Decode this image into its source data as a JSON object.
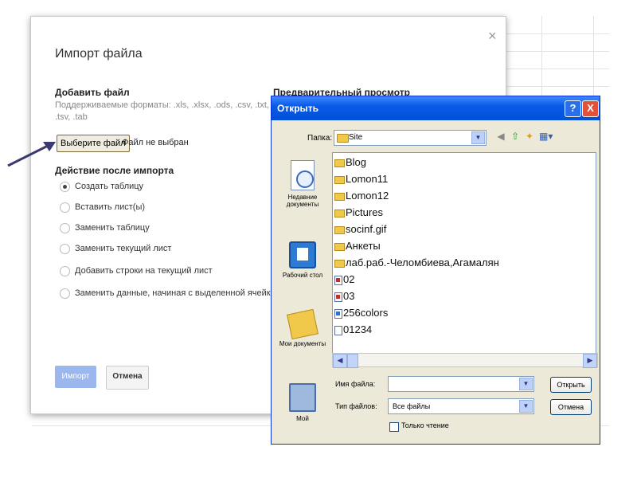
{
  "import_dialog": {
    "title": "Импорт файла",
    "close_glyph": "×",
    "add_file_heading": "Добавить файл",
    "formats_text": "Поддерживаемые форматы: .xls, .xlsx, .ods, .csv, .txt, .tsv, .tab",
    "preview_heading": "Предварительный просмотр",
    "choose_file_button": "Выберите файл",
    "no_file_text": "Файл не выбран",
    "after_import_heading": "Действие после импорта",
    "options": [
      {
        "label": "Создать таблицу",
        "selected": true
      },
      {
        "label": "Вставить лист(ы)",
        "selected": false
      },
      {
        "label": "Заменить таблицу",
        "selected": false
      },
      {
        "label": "Заменить текущий лист",
        "selected": false
      },
      {
        "label": "Добавить строки на текущий лист",
        "selected": false
      },
      {
        "label": "Заменить данные, начиная с выделенной ячейки",
        "selected": false
      }
    ],
    "import_button": "Импорт",
    "cancel_button": "Отмена"
  },
  "open_dialog": {
    "title": "Открыть",
    "help_glyph": "?",
    "close_glyph": "X",
    "folder_label": "Папка:",
    "folder_value": "Site",
    "places": {
      "recent": "Недавние документы",
      "desktop": "Рабочий стол",
      "my_documents": "Мои документы",
      "my_computer": "Мой"
    },
    "files": [
      {
        "name": "Blog",
        "icon": "folder-icon"
      },
      {
        "name": "Lomon11",
        "icon": "folder-icon"
      },
      {
        "name": "Lomon12",
        "icon": "folder-icon"
      },
      {
        "name": "Pictures",
        "icon": "folder-icon"
      },
      {
        "name": "socinf.gif",
        "icon": "folder-icon"
      },
      {
        "name": "Анкеты",
        "icon": "folder-icon"
      },
      {
        "name": "лаб.раб.-Челомбиева,Агамалян",
        "icon": "folder-icon"
      },
      {
        "name": "02",
        "icon": "presentation-file-icon"
      },
      {
        "name": "03",
        "icon": "presentation-file-icon"
      },
      {
        "name": "256colors",
        "icon": "image-file-icon"
      },
      {
        "name": "01234",
        "icon": "document-file-icon"
      }
    ],
    "filename_label": "Имя файла:",
    "filename_value": "",
    "filetype_label": "Тип файлов:",
    "filetype_value": "Все файлы",
    "readonly_label": "Только чтение",
    "open_button": "Открыть",
    "cancel_button": "Отмена"
  },
  "colors": {
    "titlebar_blue": "#0a5ae6",
    "xp_window_bg": "#ece9d8",
    "import_button_bg": "#9cb6ee",
    "arrow": "#3b3a6e"
  }
}
